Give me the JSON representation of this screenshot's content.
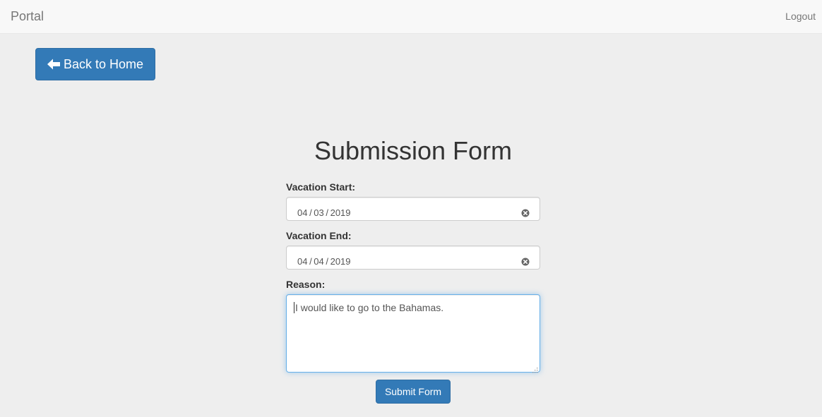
{
  "navbar": {
    "brand": "Portal",
    "logout_label": "Logout"
  },
  "back_button": {
    "label": "Back to Home",
    "icon": "arrow-left-icon"
  },
  "form": {
    "title": "Submission Form",
    "vacation_start": {
      "label": "Vacation Start:",
      "value": "04 / 03 / 2019"
    },
    "vacation_end": {
      "label": "Vacation End:",
      "value": "04 / 04 / 2019"
    },
    "reason": {
      "label": "Reason:",
      "value": "I would like to go to the Bahamas."
    },
    "submit_label": "Submit Form"
  },
  "colors": {
    "primary": "#337ab7",
    "background": "#eeeeee",
    "navbar": "#f8f8f8",
    "focus_border": "#66afe9"
  }
}
